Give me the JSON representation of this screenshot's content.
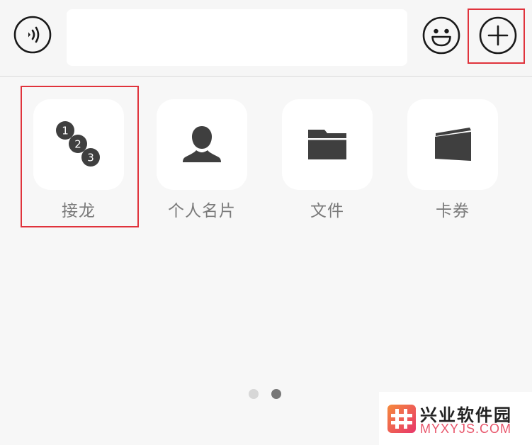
{
  "input_bar": {
    "voice_icon": "voice-wave-icon",
    "text_value": "",
    "emoji_icon": "smiley-icon",
    "plus_icon": "plus-circle-icon"
  },
  "panel": {
    "items": [
      {
        "label": "接龙",
        "icon": "numbered-dots-icon",
        "badge_numbers": [
          "1",
          "2",
          "3"
        ]
      },
      {
        "label": "个人名片",
        "icon": "person-icon"
      },
      {
        "label": "文件",
        "icon": "folder-icon"
      },
      {
        "label": "卡券",
        "icon": "card-wallet-icon"
      }
    ],
    "page_count": 2,
    "active_page": 2
  },
  "colors": {
    "highlight": "#e0333c",
    "icon_dark": "#3f3f3f",
    "label_gray": "#7b7b7b"
  },
  "watermark": {
    "title": "兴业软件园",
    "subtitle": "MYXYJS.COM"
  }
}
